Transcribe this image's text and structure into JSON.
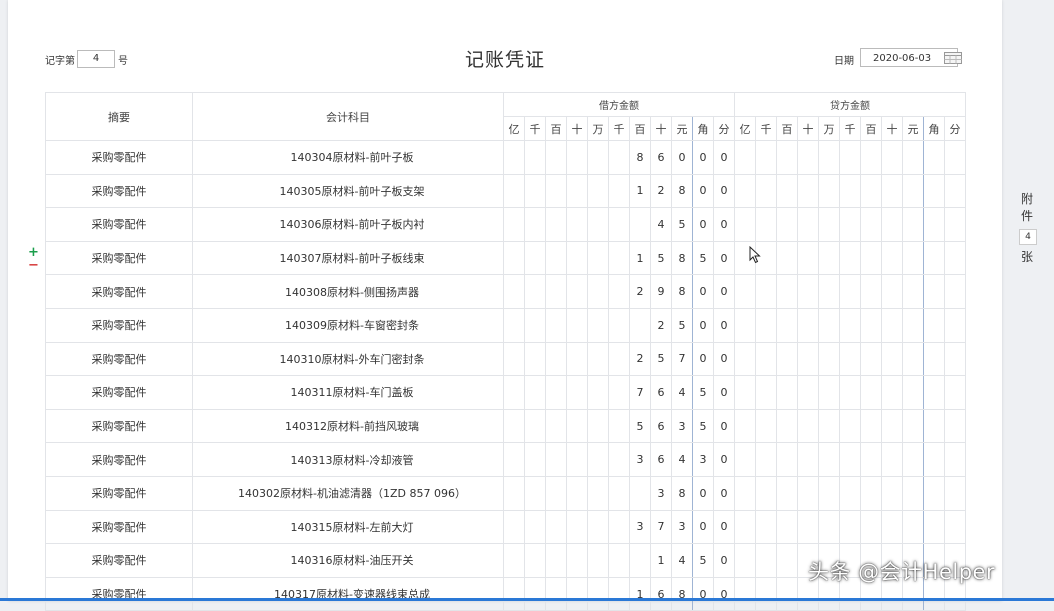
{
  "voucher": {
    "number_prefix": "记字第",
    "number": "4",
    "number_suffix": "号",
    "title": "记账凭证",
    "date_label": "日期",
    "date": "2020-06-03"
  },
  "columns": {
    "summary": "摘要",
    "account": "会计科目",
    "debit": "借方金额",
    "credit": "贷方金额",
    "digit_units": [
      "亿",
      "千",
      "百",
      "十",
      "万",
      "千",
      "百",
      "十",
      "元",
      "角",
      "分"
    ]
  },
  "rows": [
    {
      "summary": "采购零配件",
      "account": "140304原材料-前叶子板",
      "debit": [
        "",
        "",
        "",
        "",
        "",
        "",
        "8",
        "6",
        "0",
        "0",
        "0"
      ]
    },
    {
      "summary": "采购零配件",
      "account": "140305原材料-前叶子板支架",
      "debit": [
        "",
        "",
        "",
        "",
        "",
        "",
        "1",
        "2",
        "8",
        "0",
        "0"
      ]
    },
    {
      "summary": "采购零配件",
      "account": "140306原材料-前叶子板内衬",
      "debit": [
        "",
        "",
        "",
        "",
        "",
        "",
        "",
        "4",
        "5",
        "0",
        "0"
      ]
    },
    {
      "summary": "采购零配件",
      "account": "140307原材料-前叶子板线束",
      "debit": [
        "",
        "",
        "",
        "",
        "",
        "",
        "1",
        "5",
        "8",
        "5",
        "0"
      ]
    },
    {
      "summary": "采购零配件",
      "account": "140308原材料-侧围扬声器",
      "debit": [
        "",
        "",
        "",
        "",
        "",
        "",
        "2",
        "9",
        "8",
        "0",
        "0"
      ]
    },
    {
      "summary": "采购零配件",
      "account": "140309原材料-车窗密封条",
      "debit": [
        "",
        "",
        "",
        "",
        "",
        "",
        "",
        "2",
        "5",
        "0",
        "0"
      ]
    },
    {
      "summary": "采购零配件",
      "account": "140310原材料-外车门密封条",
      "debit": [
        "",
        "",
        "",
        "",
        "",
        "",
        "2",
        "5",
        "7",
        "0",
        "0"
      ]
    },
    {
      "summary": "采购零配件",
      "account": "140311原材料-车门盖板",
      "debit": [
        "",
        "",
        "",
        "",
        "",
        "",
        "7",
        "6",
        "4",
        "5",
        "0"
      ]
    },
    {
      "summary": "采购零配件",
      "account": "140312原材料-前挡风玻璃",
      "debit": [
        "",
        "",
        "",
        "",
        "",
        "",
        "5",
        "6",
        "3",
        "5",
        "0"
      ]
    },
    {
      "summary": "采购零配件",
      "account": "140313原材料-冷却液管",
      "debit": [
        "",
        "",
        "",
        "",
        "",
        "",
        "3",
        "6",
        "4",
        "3",
        "0"
      ]
    },
    {
      "summary": "采购零配件",
      "account": "140302原材料-机油滤清器（1ZD 857 096）",
      "debit": [
        "",
        "",
        "",
        "",
        "",
        "",
        "",
        "3",
        "8",
        "0",
        "0"
      ]
    },
    {
      "summary": "采购零配件",
      "account": "140315原材料-左前大灯",
      "debit": [
        "",
        "",
        "",
        "",
        "",
        "",
        "3",
        "7",
        "3",
        "0",
        "0"
      ]
    },
    {
      "summary": "采购零配件",
      "account": "140316原材料-油压开关",
      "debit": [
        "",
        "",
        "",
        "",
        "",
        "",
        "",
        "1",
        "4",
        "5",
        "0"
      ]
    },
    {
      "summary": "采购零配件",
      "account": "140317原材料-变速器线束总成",
      "debit": [
        "",
        "",
        "",
        "",
        "",
        "",
        "1",
        "6",
        "8",
        "0",
        "0"
      ]
    }
  ],
  "row_controls": {
    "add": "+",
    "remove": "−"
  },
  "attachments": {
    "label_top": "附",
    "label_mid": "件",
    "count": "4",
    "label_bottom": "张"
  },
  "watermark": "头条 @会计Helper",
  "colors": {
    "accent": "#2a78d6",
    "add": "#1a9e4b",
    "remove": "#d63a3a",
    "grid": "#e2e4e8",
    "unit_separator": "#9fb4d4"
  }
}
